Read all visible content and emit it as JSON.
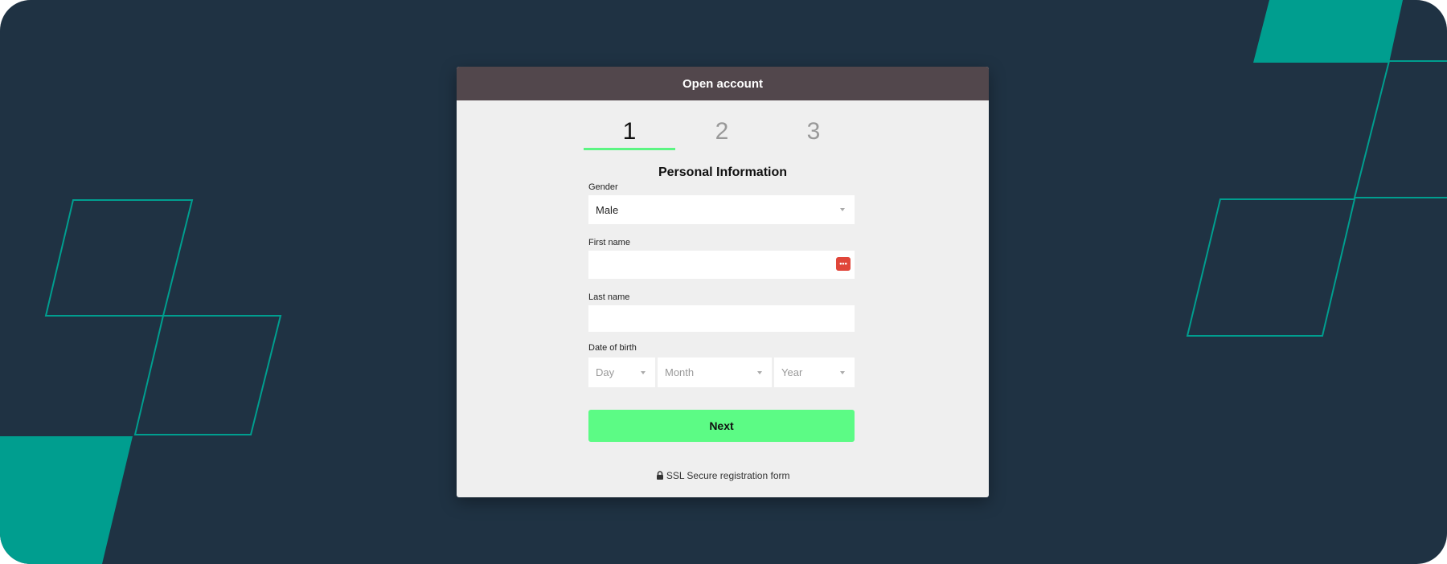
{
  "colors": {
    "background": "#1f3243",
    "accent_teal": "#009e8f",
    "header": "#52474c",
    "next_button": "#5cfb85",
    "active_step": "#5cf583"
  },
  "modal": {
    "title": "Open account",
    "steps": [
      "1",
      "2",
      "3"
    ],
    "active_step": 1,
    "section_title": "Personal Information",
    "gender": {
      "label": "Gender",
      "value": "Male"
    },
    "first_name": {
      "label": "First name",
      "value": "",
      "icon": "password-manager-icon"
    },
    "last_name": {
      "label": "Last name",
      "value": ""
    },
    "dob": {
      "label": "Date of birth",
      "day_placeholder": "Day",
      "month_placeholder": "Month",
      "year_placeholder": "Year"
    },
    "next_label": "Next",
    "ssl_text": "SSL Secure registration form",
    "ssl_icon": "lock-icon"
  }
}
